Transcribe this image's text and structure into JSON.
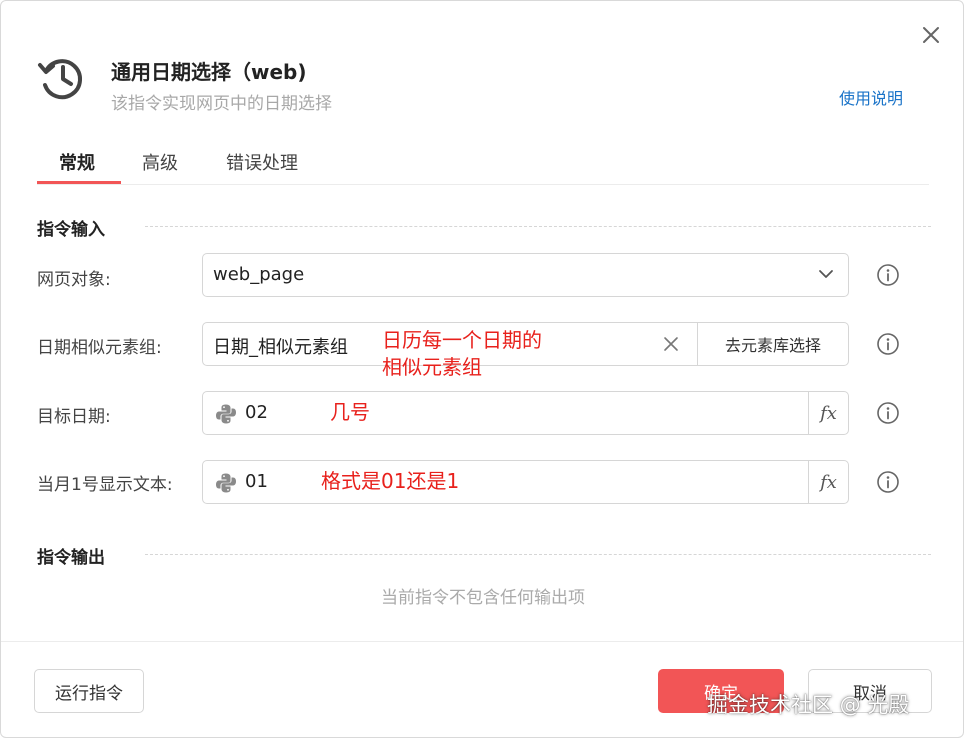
{
  "header": {
    "title": "通用日期选择（web)",
    "subtitle": "该指令实现网页中的日期选择",
    "help_link": "使用说明",
    "icon": "history-icon"
  },
  "tabs": [
    {
      "label": "常规",
      "active": true
    },
    {
      "label": "高级",
      "active": false
    },
    {
      "label": "错误处理",
      "active": false
    }
  ],
  "input_section": {
    "title": "指令输入",
    "fields": [
      {
        "label": "网页对象:",
        "value": "web_page",
        "type": "select"
      },
      {
        "label": "日期相似元素组:",
        "value": "日期_相似元素组",
        "button": "去元素库选择",
        "annotation": "日历每一个日期的\n相似元素组"
      },
      {
        "label": "目标日期:",
        "value": "02",
        "fx": "fx",
        "annotation": "几号"
      },
      {
        "label": "当月1号显示文本:",
        "value": "01",
        "fx": "fx",
        "annotation": "格式是01还是1"
      }
    ]
  },
  "output_section": {
    "title": "指令输出",
    "empty_text": "当前指令不包含任何输出项"
  },
  "footer": {
    "run_label": "运行指令",
    "ok_label": "确定",
    "cancel_label": "取消"
  },
  "watermark": "掘金技术社区 @ 光殿",
  "colors": {
    "accent": "#f25556",
    "link": "#1a73c8",
    "annotation": "#e8211c"
  }
}
